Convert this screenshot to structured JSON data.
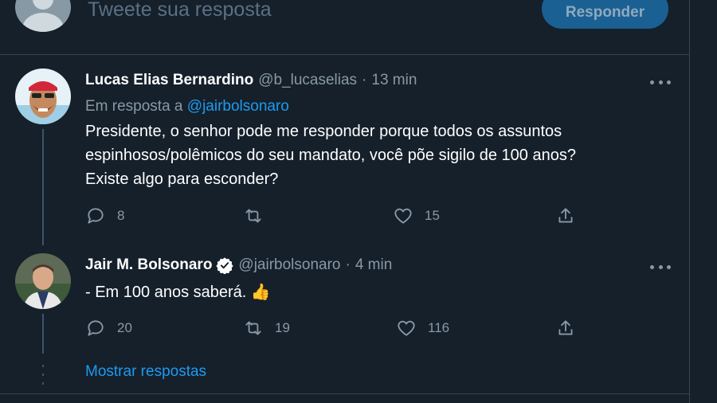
{
  "composer": {
    "placeholder": "Tweete sua resposta",
    "reply_button": "Responder"
  },
  "tweets": [
    {
      "name": "Lucas Elias Bernardino",
      "handle": "@b_lucaselias",
      "time": "13 min",
      "replying_prefix": "Em resposta a",
      "replying_to": "@jairbolsonaro",
      "lines": [
        "Presidente, o senhor pode me responder porque todos os assuntos",
        "espinhosos/polêmicos do seu mandato, você põe sigilo de 100 anos?",
        "Existe algo para esconder?"
      ],
      "replies": "8",
      "retweets": "",
      "likes": "15"
    },
    {
      "name": "Jair M. Bolsonaro",
      "handle": "@jairbolsonaro",
      "time": "4 min",
      "verified": true,
      "lines": [
        "- Em 100 anos saberá. 👍"
      ],
      "replies": "20",
      "retweets": "19",
      "likes": "116"
    }
  ],
  "show_replies": "Mostrar respostas",
  "colors": {
    "background": "#15202b",
    "accent": "#1d9bf0",
    "muted": "#8899a6",
    "border": "#38444d"
  },
  "icons": [
    "reply-icon",
    "retweet-icon",
    "like-icon",
    "share-icon",
    "more-icon",
    "verified-badge-icon"
  ]
}
